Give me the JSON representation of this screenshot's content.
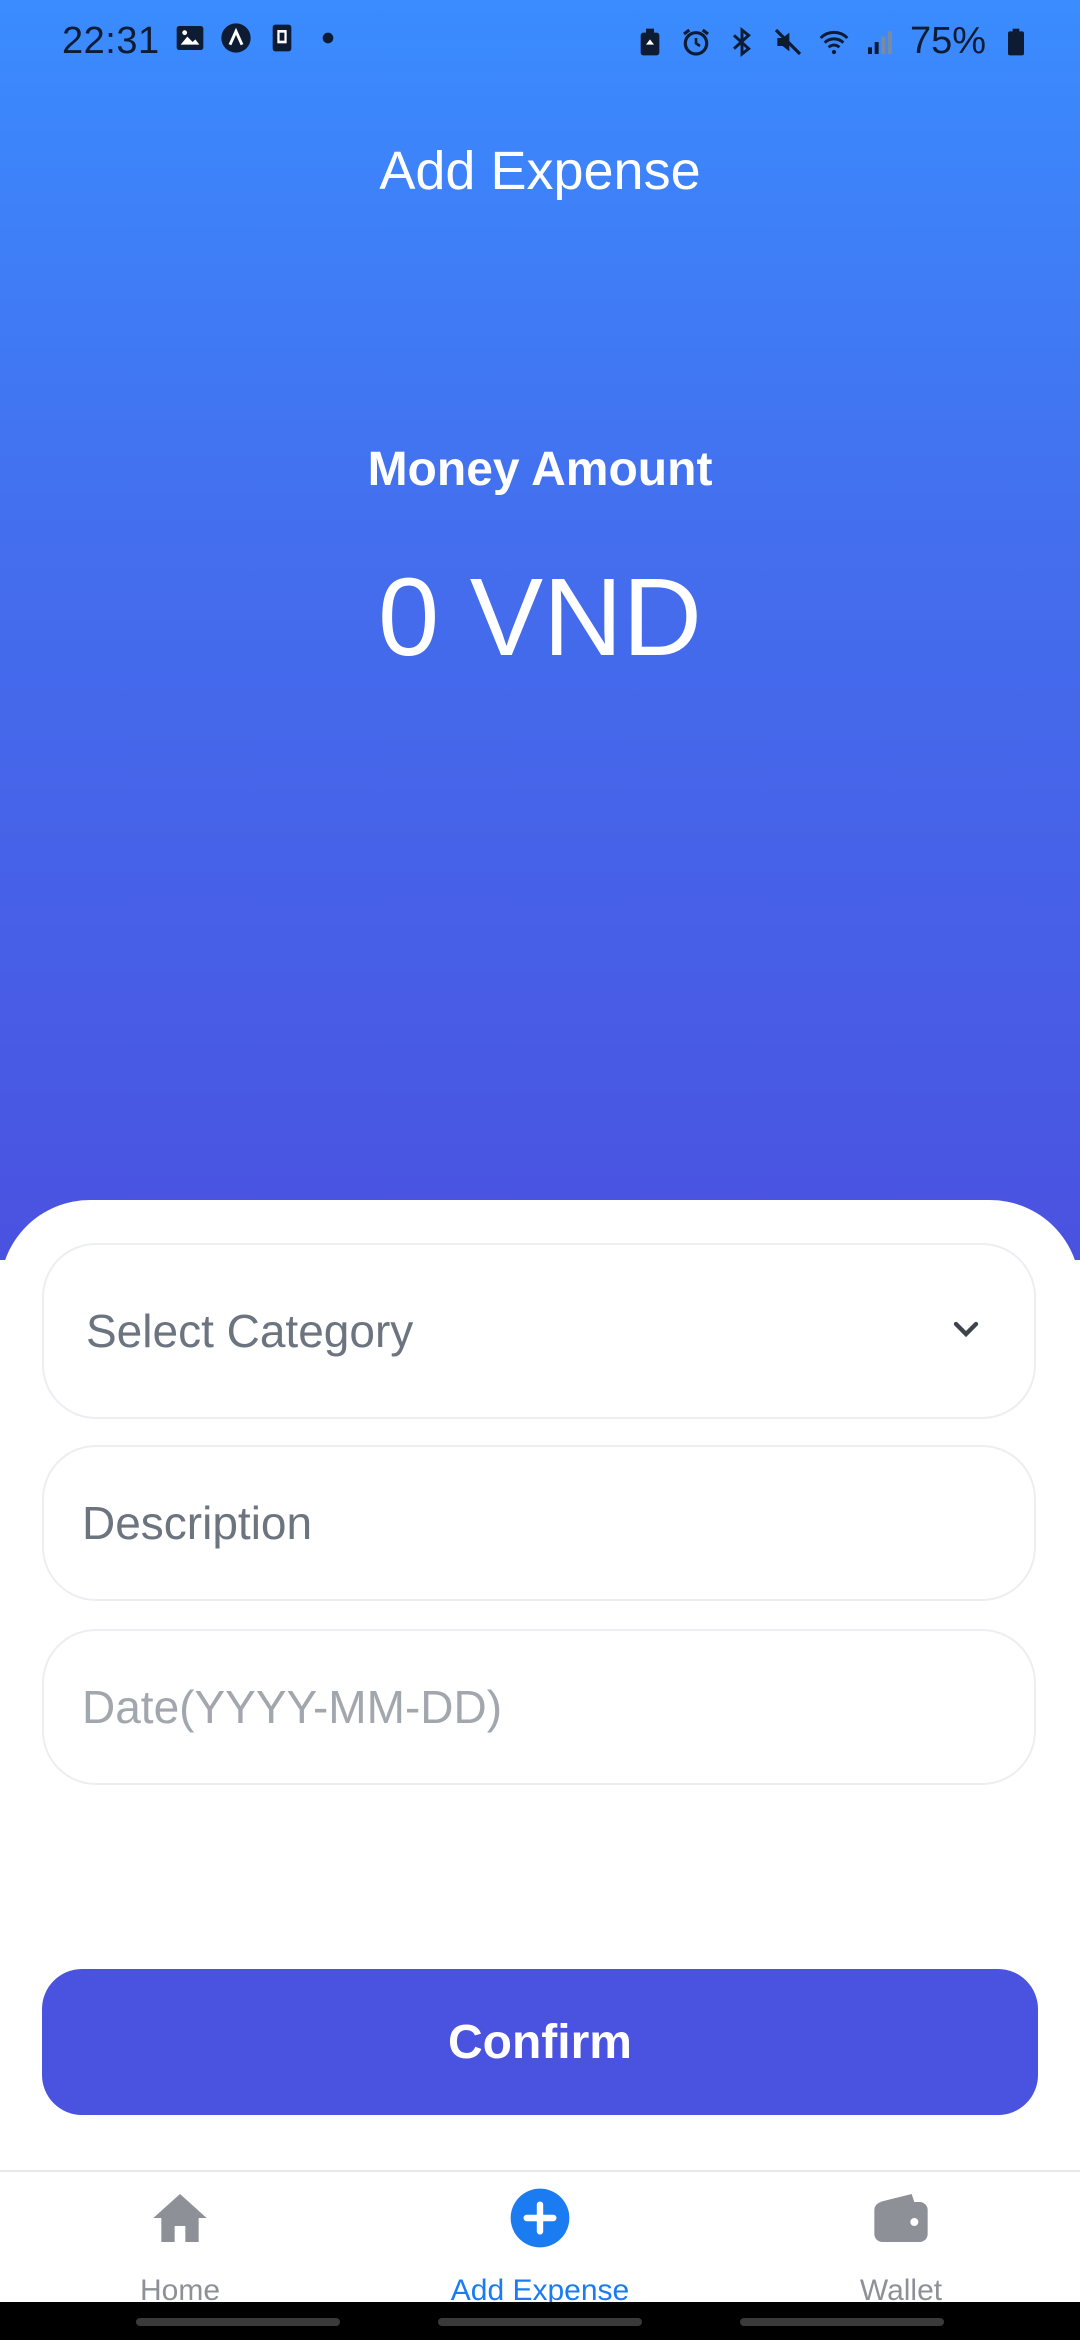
{
  "status_bar": {
    "time": "22:31",
    "battery": "75%",
    "left_icons": [
      "gallery-icon",
      "app-a-icon",
      "sim-icon",
      "dot-icon"
    ],
    "right_icons": [
      "recycle-icon",
      "alarm-icon",
      "bluetooth-icon",
      "mute-icon",
      "wifi-icon",
      "signal-icon",
      "battery-icon"
    ]
  },
  "header": {
    "title": "Add Expense"
  },
  "amount": {
    "label": "Money Amount",
    "value": "0 VND"
  },
  "form": {
    "category": {
      "value": "Select Category",
      "icon": "chevron-down-icon"
    },
    "description": {
      "placeholder": "Description"
    },
    "date": {
      "placeholder": "Date(YYYY-MM-DD)"
    }
  },
  "confirm_label": "Confirm",
  "nav": {
    "items": [
      {
        "label": "Home",
        "icon": "home-icon",
        "active": false
      },
      {
        "label": "Add Expense",
        "icon": "plus-circle-icon",
        "active": true
      },
      {
        "label": "Wallet",
        "icon": "wallet-icon",
        "active": false
      }
    ]
  },
  "colors": {
    "gradient_top": "#3a8cff",
    "gradient_bottom": "#4a52e0",
    "primary": "#4a52e0",
    "active_nav": "#1a7cf0",
    "inactive_nav": "#8d9197"
  }
}
